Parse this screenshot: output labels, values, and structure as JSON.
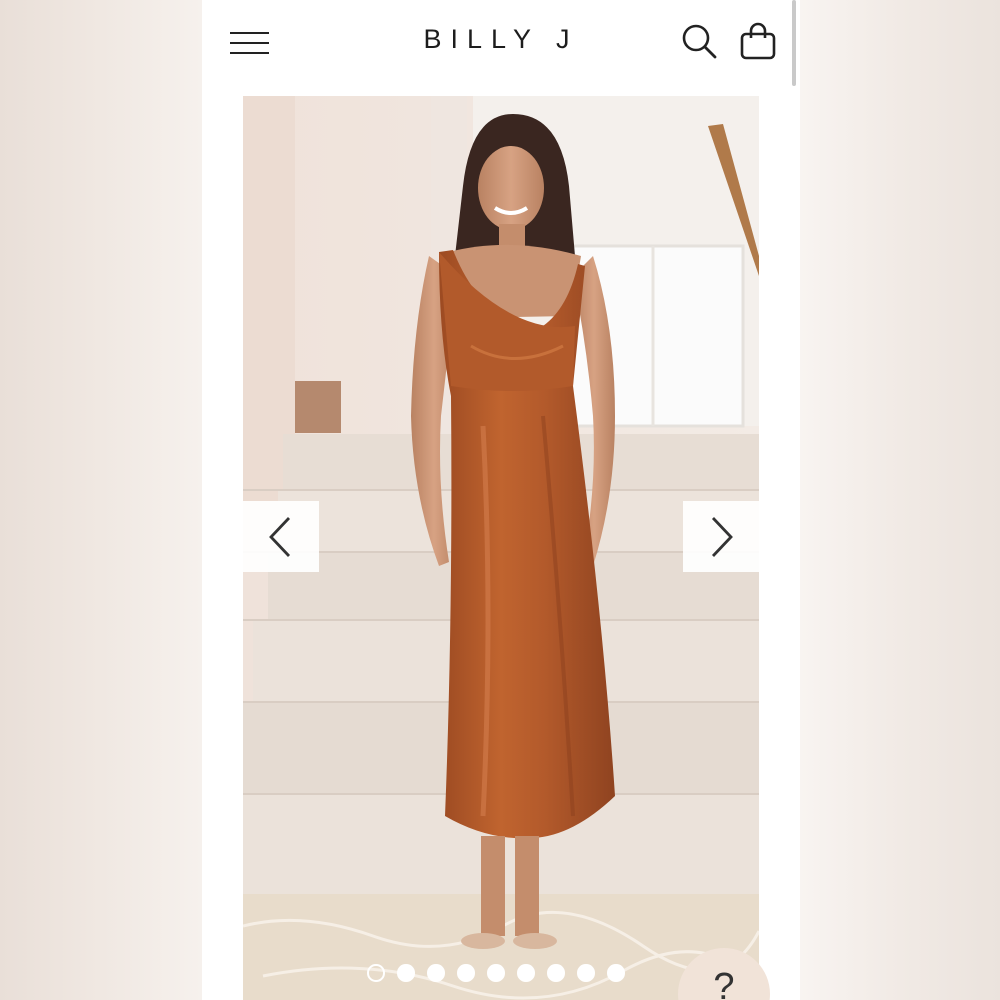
{
  "header": {
    "brand": "BILLY J",
    "menu_icon": "hamburger-menu-icon",
    "search_icon": "search-icon",
    "bag_icon": "shopping-bag-icon"
  },
  "gallery": {
    "prev_icon": "chevron-left-icon",
    "next_icon": "chevron-right-icon",
    "slide_count": 9,
    "active_slide": 1,
    "dress_color": "#b45a2c"
  },
  "help": {
    "label": "?"
  }
}
